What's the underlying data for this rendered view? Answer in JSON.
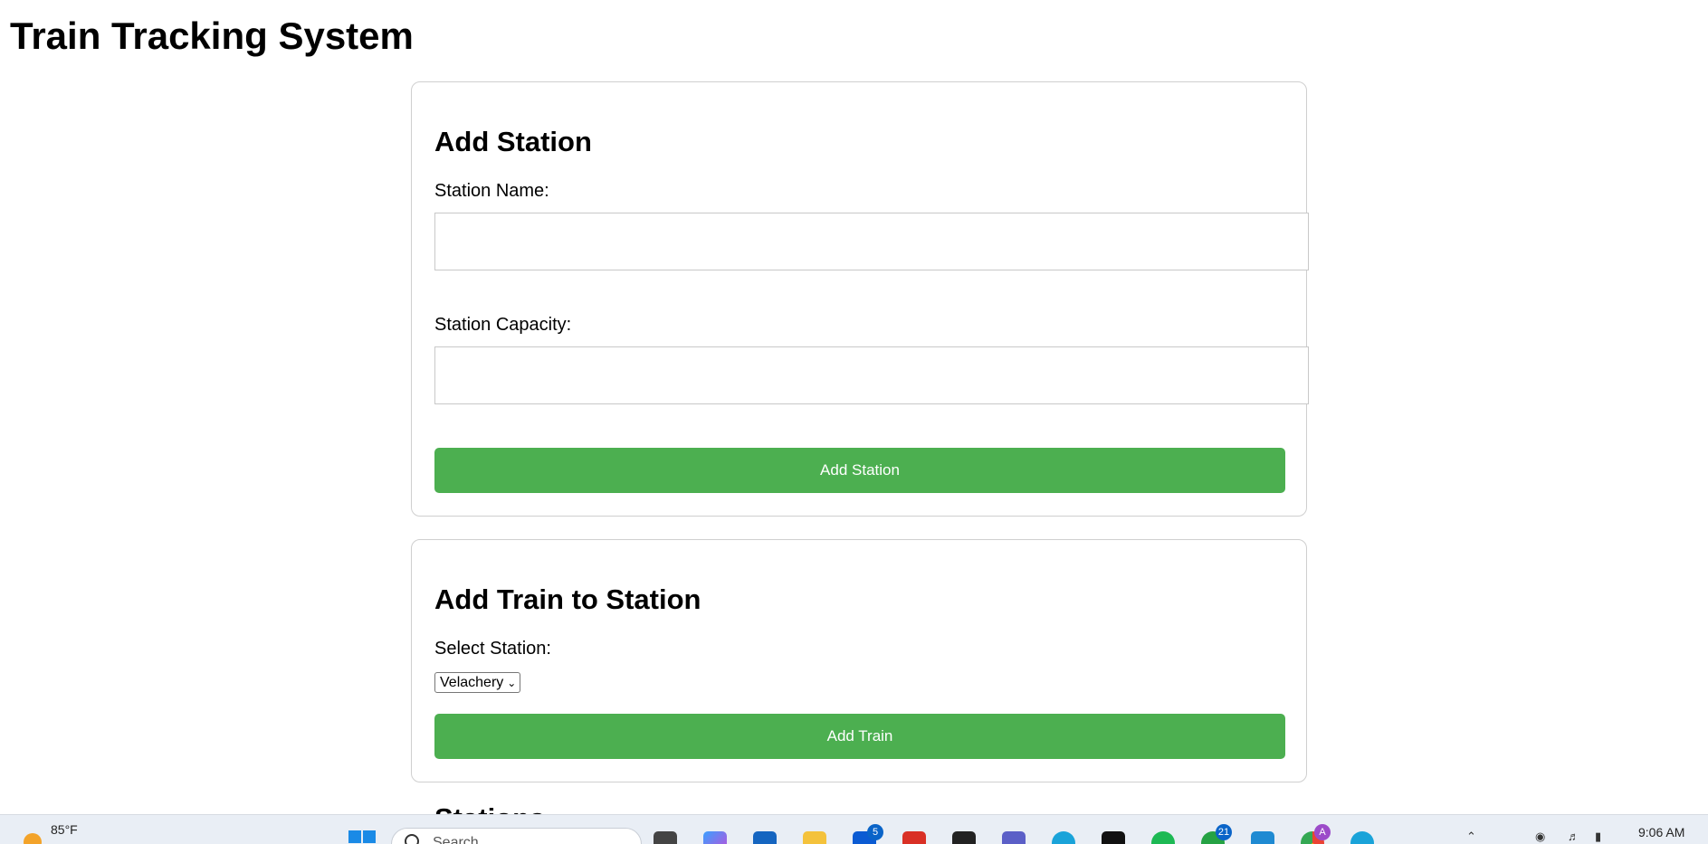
{
  "page": {
    "title": "Train Tracking System"
  },
  "add_station": {
    "heading": "Add Station",
    "name_label": "Station Name:",
    "name_value": "",
    "capacity_label": "Station Capacity:",
    "capacity_value": "",
    "button": "Add Station"
  },
  "add_train": {
    "heading": "Add Train to Station",
    "select_label": "Select Station:",
    "selected_station": "Velachery",
    "button": "Add Train"
  },
  "stations": {
    "heading": "Stations"
  },
  "taskbar": {
    "temperature": "85°F",
    "search_text": "Search",
    "badges": {
      "trello": "5",
      "whatsapp": "21"
    },
    "profile_letter": "A",
    "time": "9:06 AM"
  },
  "colors": {
    "accent_button": "#4caf50",
    "card_border": "#cfcfcf"
  },
  "icons": [
    "weather-icon",
    "windows-start-icon",
    "search-icon",
    "task-view-icon",
    "copilot-icon",
    "store-icon",
    "file-explorer-icon",
    "trello-icon",
    "gmail-icon",
    "dropbox-icon",
    "teams-icon",
    "edge-icon",
    "app-icon",
    "spotify-icon",
    "whatsapp-icon",
    "vscode-icon",
    "chrome-icon",
    "edge-dev-icon"
  ]
}
